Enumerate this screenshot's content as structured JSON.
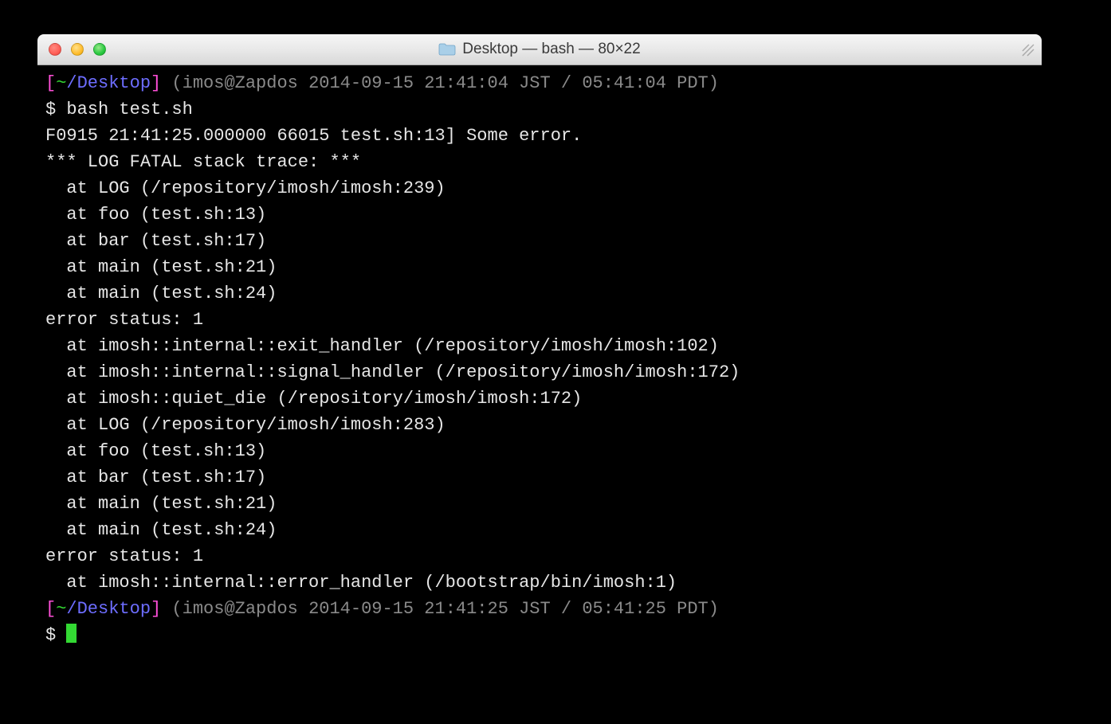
{
  "window": {
    "title": "Desktop — bash — 80×22"
  },
  "prompt1": {
    "open": "[",
    "tilde": "~",
    "path": "/Desktop",
    "close": "]",
    "meta": " (imos@Zapdos 2014-09-15 21:41:04 JST / 05:41:04 PDT)"
  },
  "cmd": "$ bash test.sh",
  "out": [
    "F0915 21:41:25.000000 66015 test.sh:13] Some error.",
    "*** LOG FATAL stack trace: ***",
    "  at LOG (/repository/imosh/imosh:239)",
    "  at foo (test.sh:13)",
    "  at bar (test.sh:17)",
    "  at main (test.sh:21)",
    "  at main (test.sh:24)",
    "error status: 1",
    "  at imosh::internal::exit_handler (/repository/imosh/imosh:102)",
    "  at imosh::internal::signal_handler (/repository/imosh/imosh:172)",
    "  at imosh::quiet_die (/repository/imosh/imosh:172)",
    "  at LOG (/repository/imosh/imosh:283)",
    "  at foo (test.sh:13)",
    "  at bar (test.sh:17)",
    "  at main (test.sh:21)",
    "  at main (test.sh:24)",
    "error status: 1",
    "  at imosh::internal::error_handler (/bootstrap/bin/imosh:1)"
  ],
  "prompt2": {
    "open": "[",
    "tilde": "~",
    "path": "/Desktop",
    "close": "]",
    "meta": " (imos@Zapdos 2014-09-15 21:41:25 JST / 05:41:25 PDT)"
  },
  "cmd2": "$ "
}
